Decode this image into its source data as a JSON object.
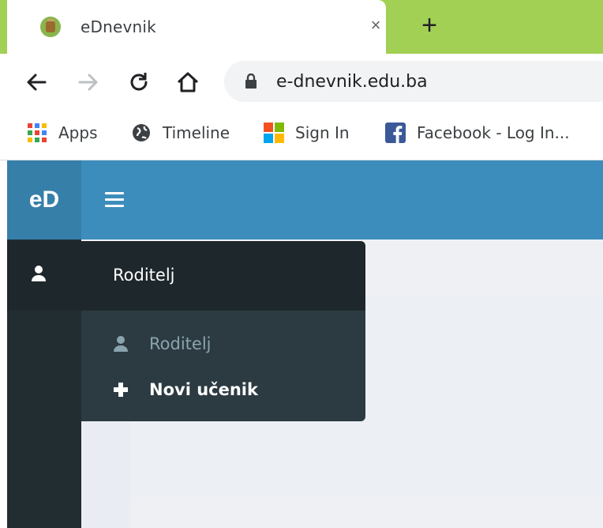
{
  "browser": {
    "tab": {
      "title": "eDnevnik",
      "close_glyph": "×",
      "favicon": "ednevnik-favicon"
    },
    "new_tab_glyph": "+",
    "toolbar": {
      "url": "e-dnevnik.edu.ba"
    },
    "bookmarks": [
      {
        "label": "Apps",
        "icon": "apps-grid-icon"
      },
      {
        "label": "Timeline",
        "icon": "globe-icon"
      },
      {
        "label": "Sign In",
        "icon": "microsoft-logo-icon"
      },
      {
        "label": "Facebook - Log In...",
        "icon": "facebook-icon"
      }
    ]
  },
  "app": {
    "brand": "eD",
    "menu": {
      "section_label": "Roditelj",
      "items": [
        {
          "label": "Roditelj",
          "icon": "user-icon"
        },
        {
          "label": "Novi učenik",
          "icon": "plus-icon"
        }
      ]
    }
  },
  "colors": {
    "tab_strip": "#a2d055",
    "navbar": "#3c8dbc",
    "brand_bg": "#367fa9",
    "sidebar": "#222d32",
    "submenu": "#2c3b41",
    "content_bg": "#ecf0f5"
  }
}
